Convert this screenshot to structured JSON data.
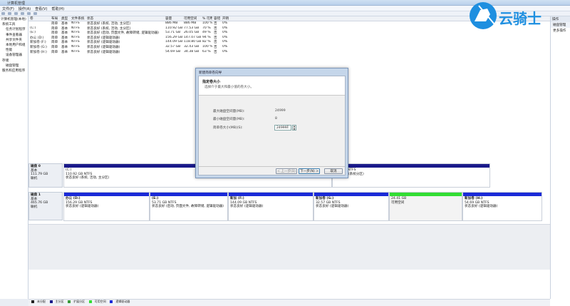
{
  "window": {
    "title": "计算机管理"
  },
  "menubar": [
    "文件(F)",
    "操作(A)",
    "查看(V)",
    "帮助(H)"
  ],
  "tree": [
    "计算机管理(本地)",
    "系统工具",
    "任务计划程序",
    "事件查看器",
    "共享文件夹",
    "本地用户和组",
    "性能",
    "设备管理器",
    "存储",
    "磁盘管理",
    "服务和应用程序"
  ],
  "volume_table": {
    "columns": [
      "卷",
      "布局",
      "类型",
      "文件系统",
      "状态",
      "容量",
      "可用空间",
      "% 可用",
      "容错",
      "开销"
    ],
    "rows": [
      [
        "",
        "简单",
        "基本",
        "NTFS",
        "状态良好 (系统, 活动, 主分区)",
        "886 MB",
        "886 MB",
        "100 %",
        "否",
        "0%"
      ],
      [
        "(C:)",
        "简单",
        "基本",
        "NTFS",
        "状态良好 (系统, 活动, 主分区)",
        "110.92 GB",
        "77.53 GB",
        "70 %",
        "否",
        "0%"
      ],
      [
        "(E:)",
        "简单",
        "基本",
        "NTFS",
        "状态良好 (启动, 页面文件, 故障转储, 逻辑驱动器)",
        "53.71 GB",
        "26.05 GB",
        "49 %",
        "否",
        "0%"
      ],
      [
        "办公 (D:)",
        "简单",
        "基本",
        "NTFS",
        "状态良好 (逻辑驱动器)",
        "156.29 GB",
        "147.07 GB",
        "94 %",
        "否",
        "0%"
      ],
      [
        "新加卷 (F:)",
        "简单",
        "基本",
        "NTFS",
        "状态良好 (逻辑驱动器)",
        "144.09 GB",
        "118.80 GB",
        "82 %",
        "否",
        "0%"
      ],
      [
        "新加卷 (G:)",
        "简单",
        "基本",
        "NTFS",
        "状态良好 (逻辑驱动器)",
        "32.57 GB",
        "32.43 GB",
        "100 %",
        "否",
        "0%"
      ],
      [
        "新加卷 (H:)",
        "简单",
        "基本",
        "NTFS",
        "状态良好 (逻辑驱动器)",
        "54.69 GB",
        "34.38 GB",
        "63 %",
        "否",
        "0%"
      ]
    ]
  },
  "actions": {
    "header": "操作",
    "section": "磁盘管理",
    "item": "更多操作"
  },
  "logo": {
    "text": "云骑士"
  },
  "dialog": {
    "title": "新建简单卷向导",
    "heading": "指定卷大小",
    "subheading": "选择介于最大和最小值的卷大小。",
    "max_label": "最大磁盘空间量(MB):",
    "max_value": "24999",
    "min_label": "最小磁盘空间量(MB):",
    "min_value": "8",
    "size_label": "简单卷大小(MB)(S):",
    "size_value": "24999",
    "back_button": "< 上一步(B)",
    "next_button": "下一步(N) >",
    "cancel_button": "取消"
  },
  "disk0": {
    "label": [
      "磁盘 0",
      "基本",
      "111.79 GB",
      "联机"
    ],
    "partitions": [
      {
        "name": "(C:)",
        "size": "110.92 GB NTFS",
        "status": "状态良好 (系统, 活动, 主分区)",
        "color": "#1a1a8a"
      },
      {
        "name": "",
        "size": "886 MB NTFS",
        "status": "状态良好 (系统分区)",
        "color": "#1a1a8a"
      }
    ]
  },
  "disk1": {
    "label": [
      "磁盘 1",
      "基本",
      "465.76 GB",
      "联机"
    ],
    "partitions": [
      {
        "name": "办公 (D:)",
        "size": "156.29 GB NTFS",
        "status": "状态良好 (逻辑驱动器)",
        "color": "#1a2ad8"
      },
      {
        "name": "(E:)",
        "size": "53.71 GB NTFS",
        "status": "状态良好 (启动, 页面文件, 故障转储, 逻辑驱动器)",
        "color": "#1a2ad8"
      },
      {
        "name": "新加 (F:)",
        "size": "144.09 GB NTFS",
        "status": "状态良好 (逻辑驱动器)",
        "color": "#1a2ad8"
      },
      {
        "name": "新加卷 (G:)",
        "size": "32.57 GB NTFS",
        "status": "状态良好 (逻辑驱动器)",
        "color": "#1a2ad8"
      },
      {
        "name": "",
        "size": "24.41 GB",
        "status": "可用空间",
        "color": "#33dd33"
      },
      {
        "name": "新加卷 (H:)",
        "size": "54.69 GB NTFS",
        "status": "状态良好 (逻辑驱动器)",
        "color": "#1a2ad8"
      }
    ]
  },
  "legend": [
    "未分配",
    "主分区",
    "扩展分区",
    "可用空间",
    "逻辑驱动器"
  ],
  "colors": {
    "primary": "#1a1a8a",
    "logical": "#1a2ad8",
    "free": "#33dd33",
    "unallocated": "#222222"
  }
}
